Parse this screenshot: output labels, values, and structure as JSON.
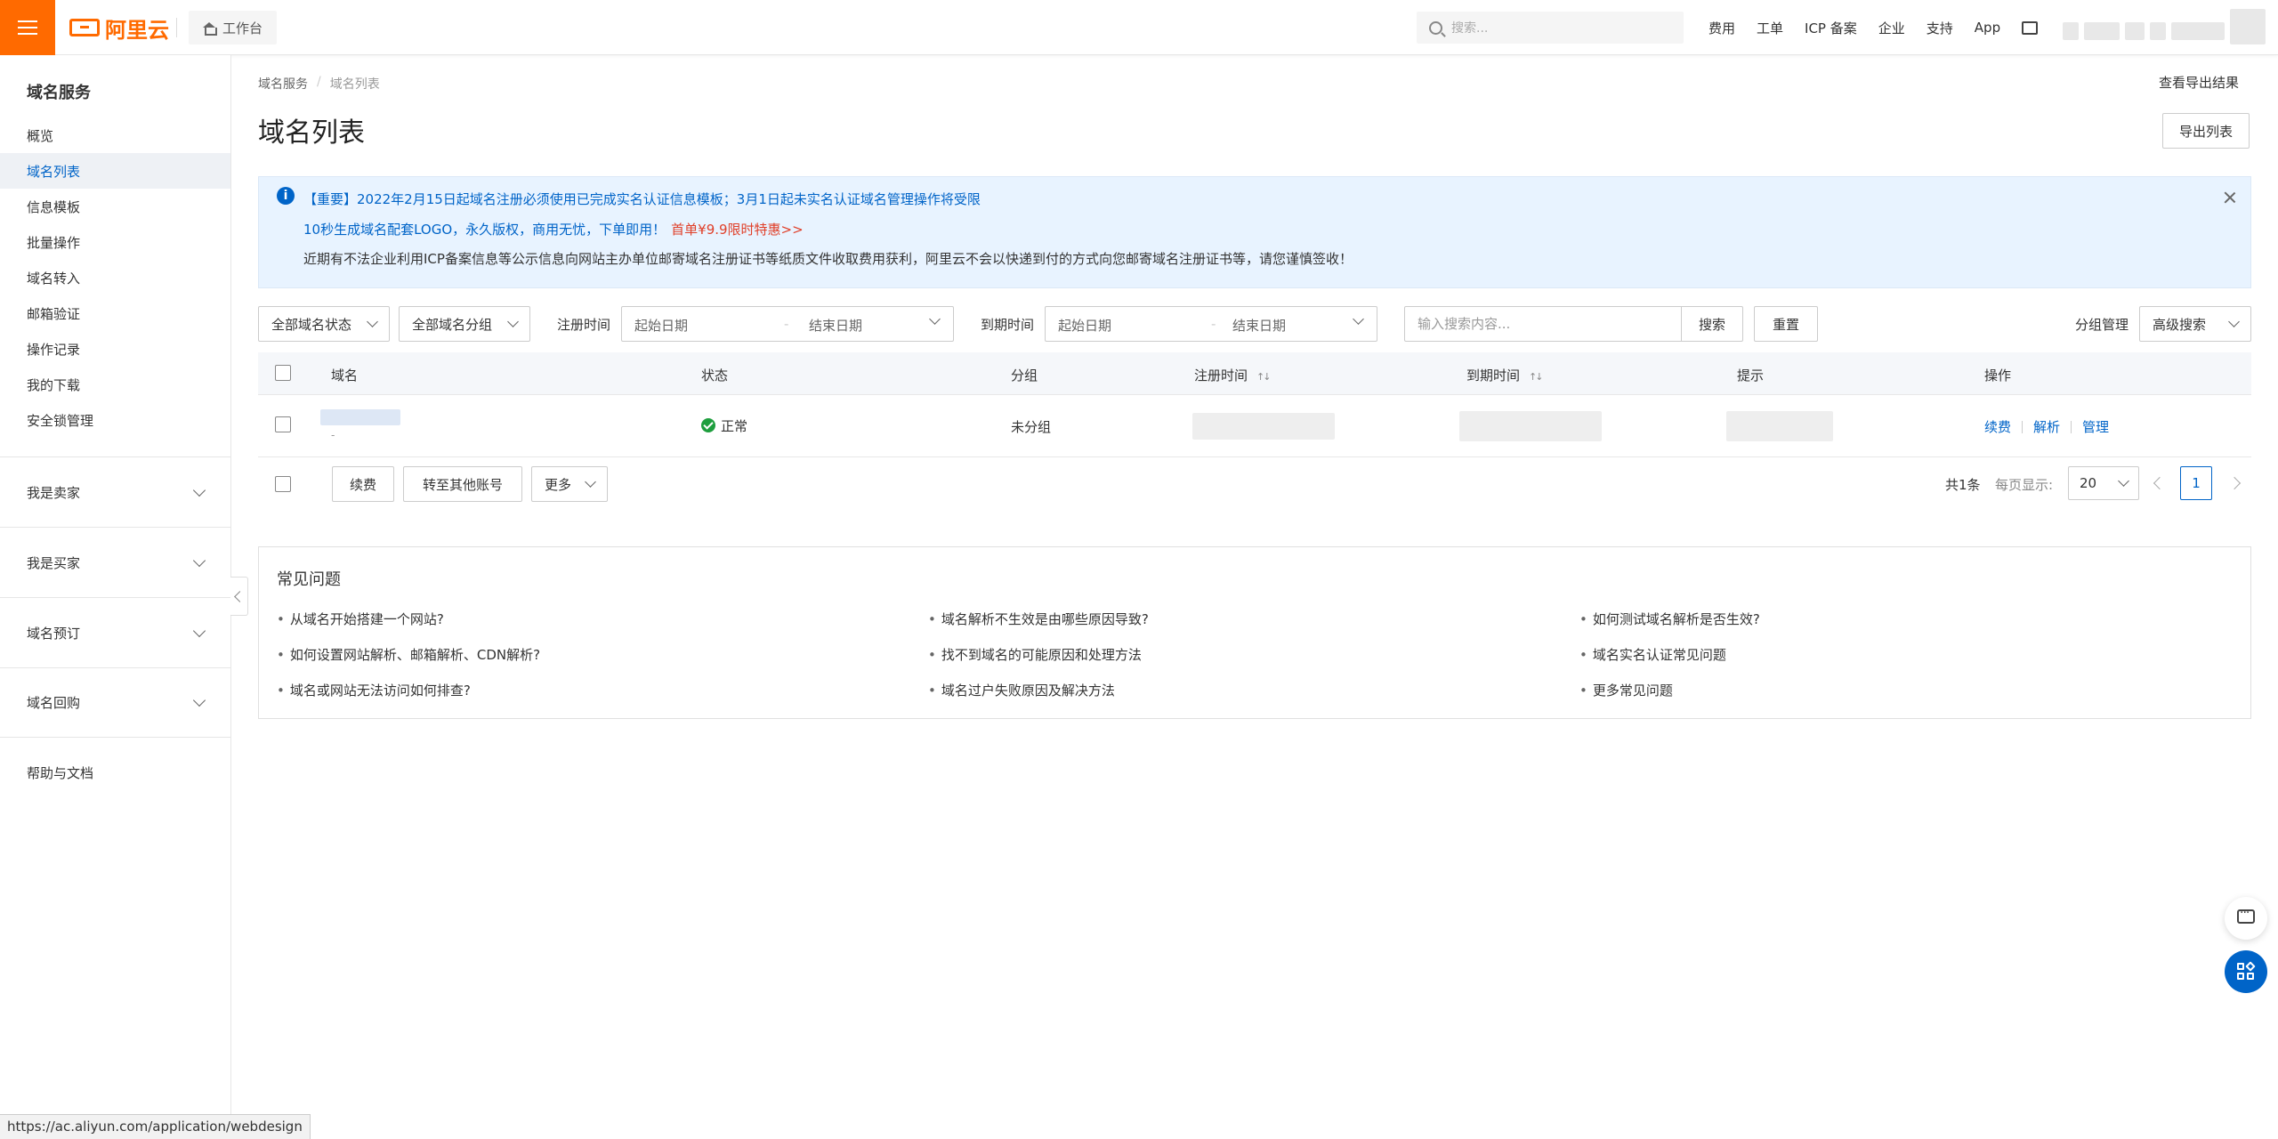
{
  "topbar": {
    "logo_text": "阿里云",
    "workbench_label": "工作台",
    "search_placeholder": "搜索...",
    "nav": [
      "费用",
      "工单",
      "ICP 备案",
      "企业",
      "支持",
      "App"
    ]
  },
  "sidebar": {
    "title": "域名服务",
    "items": [
      {
        "label": "概览",
        "active": false
      },
      {
        "label": "域名列表",
        "active": true
      },
      {
        "label": "信息模板",
        "active": false
      },
      {
        "label": "批量操作",
        "active": false
      },
      {
        "label": "域名转入",
        "active": false
      },
      {
        "label": "邮箱验证",
        "active": false
      },
      {
        "label": "操作记录",
        "active": false
      },
      {
        "label": "我的下载",
        "active": false
      },
      {
        "label": "安全锁管理",
        "active": false
      }
    ],
    "groups": [
      "我是卖家",
      "我是买家",
      "域名预订",
      "域名回购"
    ],
    "help": "帮助与文档"
  },
  "breadcrumb": {
    "parent": "域名服务",
    "current": "域名列表",
    "separator": "/"
  },
  "header": {
    "title": "域名列表",
    "export_result": "查看导出结果",
    "export_button": "导出列表"
  },
  "notice": {
    "line1": "【重要】2022年2月15日起域名注册必须使用已完成实名认证信息模板；3月1日起未实名认证域名管理操作将受限",
    "line2": "10秒生成域名配套LOGO，永久版权，商用无忧，下单即用！",
    "line2_promo": "首单¥9.9限时特惠>>",
    "line3": "近期有不法企业利用ICP备案信息等公示信息向网站主办单位邮寄域名注册证书等纸质文件收取费用获利，阿里云不会以快递到付的方式向您邮寄域名注册证书等，请您谨慎签收！"
  },
  "filters": {
    "status_select": "全部域名状态",
    "group_select": "全部域名分组",
    "reg_time_label": "注册时间",
    "exp_time_label": "到期时间",
    "start_date": "起始日期",
    "end_date": "结束日期",
    "date_dash": "-",
    "search_placeholder": "输入搜索内容...",
    "search_button": "搜索",
    "reset_button": "重置",
    "group_manage": "分组管理",
    "advanced_search": "高级搜索"
  },
  "table": {
    "columns": [
      "域名",
      "状态",
      "分组",
      "注册时间",
      "到期时间",
      "提示",
      "操作"
    ],
    "sort_glyph": "↑↓",
    "rows": [
      {
        "domain_sub": "-",
        "status": "正常",
        "group": "未分组",
        "actions": [
          "续费",
          "解析",
          "管理"
        ]
      }
    ]
  },
  "bulk": {
    "renew": "续费",
    "transfer": "转至其他账号",
    "more": "更多"
  },
  "pagination": {
    "total": "共1条",
    "per_page_label": "每页显示:",
    "per_page": "20",
    "current_page": "1"
  },
  "faq": {
    "title": "常见问题",
    "items": [
      "从域名开始搭建一个网站?",
      "域名解析不生效是由哪些原因导致?",
      "如何测试域名解析是否生效?",
      "如何设置网站解析、邮箱解析、CDN解析?",
      "找不到域名的可能原因和处理方法",
      "域名实名认证常见问题",
      "域名或网站无法访问如何排查?",
      "域名过户失败原因及解决方法",
      "更多常见问题"
    ]
  },
  "status_url": "https://ac.aliyun.com/application/webdesign",
  "colors": {
    "accent": "#ff6a00",
    "primary": "#0064c8",
    "promo": "#e0402a",
    "success": "#1e9e3e"
  }
}
